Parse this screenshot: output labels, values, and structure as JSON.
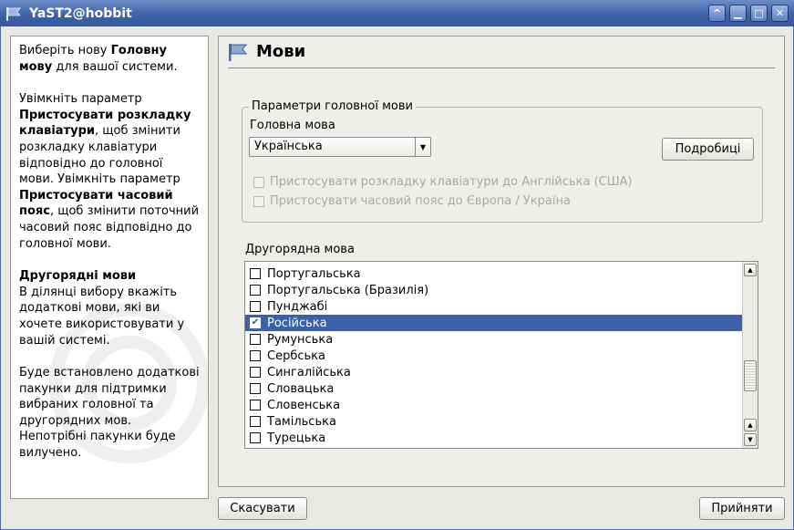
{
  "window": {
    "title": "YaST2@hobbit"
  },
  "help": {
    "p1_a": "Виберіть нову ",
    "p1_b": "Головну мову",
    "p1_c": " для вашої системи.",
    "p2_a": "Увімкніть параметр ",
    "p2_b": "Пристосувати розкладку клавіатури",
    "p2_c": ", щоб змінити розкладку клавіатури відповідно до головної мови. Увімкніть параметр ",
    "p2_d": "Пристосувати часовий пояс",
    "p2_e": ", щоб змінити поточний часовий пояс відповідно до головної мови.",
    "p3_title": "Другорядні мови",
    "p3_text": "В ділянці вибору вкажіть додаткові мови, які ви хочете використовувати у вашій системі.",
    "p4": "Буде встановлено додаткові пакунки для підтримки вибраних головної та другорядних мов. Непотрібні пакунки буде вилучено."
  },
  "page": {
    "title": "Мови"
  },
  "primary": {
    "frame_title": "Параметри головної мови",
    "label": "Головна мова",
    "selected": "Українська",
    "details_button": "Подробиці",
    "adapt_keyboard": "Пристосувати розкладку клавіатури до Англійська (США)",
    "adapt_timezone": "Пристосувати часовий пояс до Європа / Україна"
  },
  "secondary": {
    "label": "Другорядна мова",
    "items": [
      {
        "label": "Португальська",
        "checked": false
      },
      {
        "label": "Португальська (Бразилія)",
        "checked": false
      },
      {
        "label": "Пунджабі",
        "checked": false
      },
      {
        "label": "Російська",
        "checked": true
      },
      {
        "label": "Румунська",
        "checked": false
      },
      {
        "label": "Сербська",
        "checked": false
      },
      {
        "label": "Сингалійська",
        "checked": false
      },
      {
        "label": "Словацька",
        "checked": false
      },
      {
        "label": "Словенська",
        "checked": false
      },
      {
        "label": "Тамільська",
        "checked": false
      },
      {
        "label": "Турецька",
        "checked": false
      }
    ]
  },
  "buttons": {
    "cancel": "Скасувати",
    "accept": "Прийняти"
  }
}
